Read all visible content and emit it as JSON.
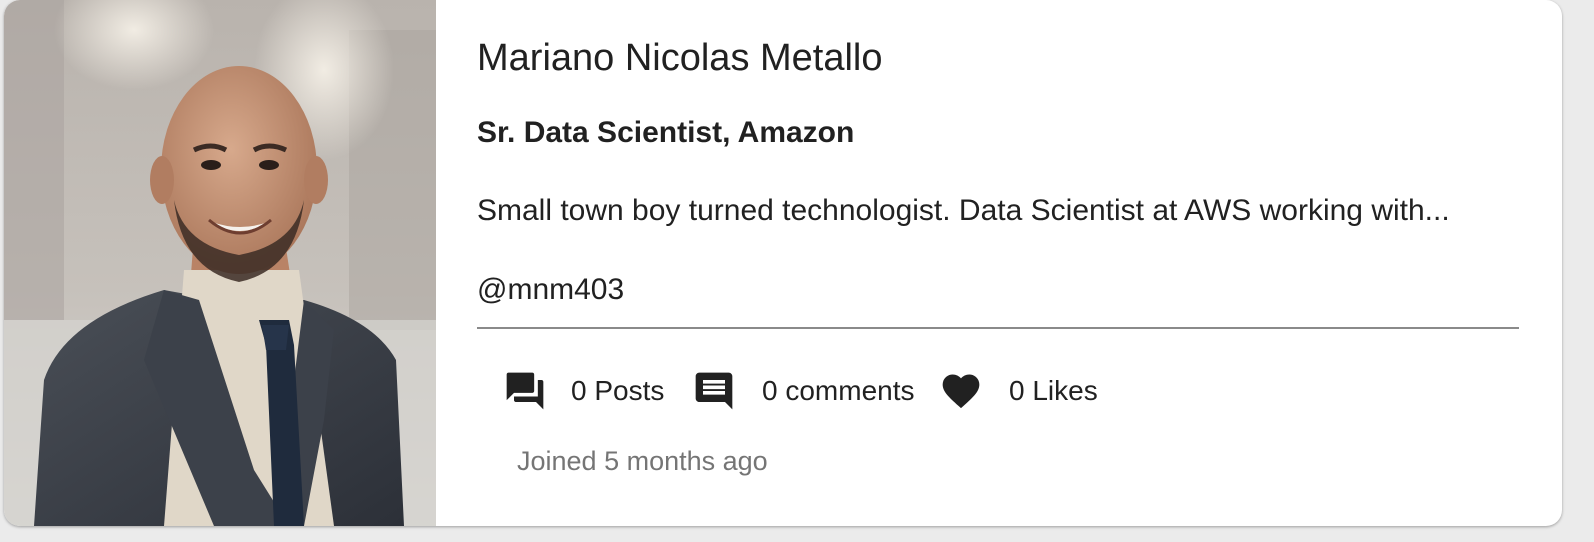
{
  "profile": {
    "name": "Mariano Nicolas Metallo",
    "title": "Sr. Data Scientist, Amazon",
    "bio": "Small town boy turned technologist. Data Scientist at AWS working with...",
    "handle": "@mnm403",
    "joined": "Joined 5 months ago"
  },
  "stats": {
    "posts": "0 Posts",
    "comments": "0 comments",
    "likes": "0 Likes"
  },
  "icons": {
    "posts": "forum-icon",
    "comments": "comment-icon",
    "likes": "heart-icon"
  },
  "colors": {
    "text": "#212121",
    "muted": "#757575",
    "divider": "#8a8a8a",
    "card": "#ffffff"
  }
}
